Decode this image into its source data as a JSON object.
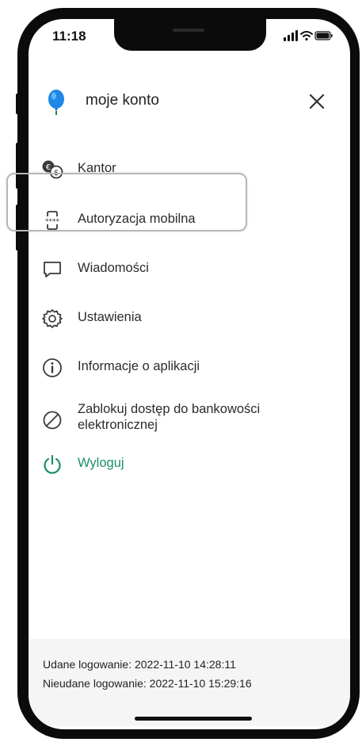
{
  "status_bar": {
    "time": "11:18"
  },
  "header": {
    "title": "moje konto"
  },
  "menu": {
    "items": [
      {
        "label": "Kantor",
        "icon": "currency-exchange-icon"
      },
      {
        "label": "Autoryzacja mobilna",
        "icon": "mobile-authorization-icon"
      },
      {
        "label": "Wiadomości",
        "icon": "message-icon"
      },
      {
        "label": "Ustawienia",
        "icon": "settings-icon"
      },
      {
        "label": "Informacje o aplikacji",
        "icon": "info-icon"
      },
      {
        "label": "Zablokuj dostęp do bankowości elektronicznej",
        "icon": "block-icon"
      },
      {
        "label": "Wyloguj",
        "icon": "power-icon"
      }
    ]
  },
  "footer": {
    "last_login": "Udane logowanie: 2022-11-10 14:28:11",
    "failed_login": "Nieudane logowanie: 2022-11-10 15:29:16"
  },
  "colors": {
    "accent": "#1b9163",
    "logo": "#1e88e5"
  }
}
